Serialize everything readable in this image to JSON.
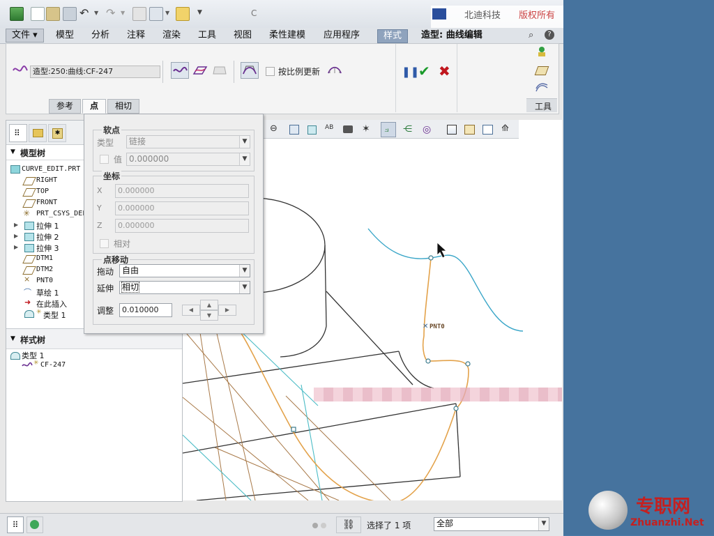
{
  "window": {
    "title": "C",
    "header_brand_a": "北迪科技",
    "header_brand_b": "版权所有"
  },
  "colors": {
    "desktop": "#46739e",
    "accent_tab": "#8fa3bd",
    "ok_green": "#1a9a2a",
    "cancel_red": "#c0161d",
    "curve_cyan": "#3aa6c8",
    "curve_orange": "#e3a24a",
    "edge_brown": "#a87948"
  },
  "menubar": {
    "file": "文件",
    "tabs": [
      "模型",
      "分析",
      "注释",
      "渲染",
      "工具",
      "视图",
      "柔性建模",
      "应用程序",
      "样式"
    ],
    "context_title": "造型: 曲线编辑"
  },
  "ribbon": {
    "curve_name": "造型:250:曲线:CF-247",
    "proportional_update": "按比例更新",
    "tools_label": "工具",
    "tabs": [
      "参考",
      "点",
      "相切"
    ]
  },
  "left_panel": {
    "model_tree_title": "模型树",
    "model_tree_items": [
      "CURVE_EDIT.PRT",
      "RIGHT",
      "TOP",
      "FRONT",
      "PRT_CSYS_DEF",
      "拉伸 1",
      "拉伸 2",
      "拉伸 3",
      "DTM1",
      "DTM2",
      "PNT0",
      "草绘 1",
      "在此插入",
      "类型 1"
    ],
    "style_tree_title": "样式树",
    "style_tree_items": [
      "类型 1",
      "CF-247"
    ]
  },
  "points_panel": {
    "soft_point": {
      "title": "软点",
      "type_label": "类型",
      "type_value": "链接",
      "value_label": "值",
      "value": "0.000000"
    },
    "coords": {
      "title": "坐标",
      "x_label": "X",
      "x": "0.000000",
      "y_label": "Y",
      "y": "0.000000",
      "z_label": "Z",
      "z": "0.000000",
      "relative_label": "相对"
    },
    "point_move": {
      "title": "点移动",
      "drag_label": "拖动",
      "drag_value": "自由",
      "extend_label": "延伸",
      "extend_value": "相切",
      "adjust_label": "调整",
      "adjust_value": "0.010000"
    }
  },
  "graphics": {
    "point_label": "PNT0"
  },
  "status_bar": {
    "selection_text": "选择了 1 项",
    "filter_value": "全部"
  },
  "watermark": {
    "cn": "专职网",
    "en": "Zhuanzhi.Net"
  }
}
